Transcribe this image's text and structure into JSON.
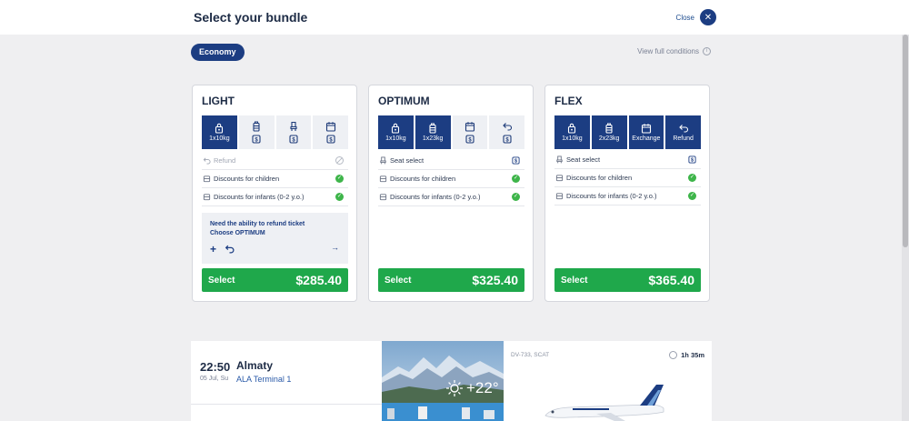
{
  "header": {
    "title": "Select your bundle",
    "close_label": "Close"
  },
  "tab": {
    "label": "Economy"
  },
  "conditions": {
    "label": "View full conditions"
  },
  "colors": {
    "brand": "#1c3d82",
    "select": "#1fa84b",
    "check": "#3eb54a"
  },
  "bundles": [
    {
      "name": "LIGHT",
      "tiles": [
        {
          "icon": "bag-lock-icon",
          "label": "1x10kg",
          "included": true
        },
        {
          "icon": "luggage-icon",
          "label": "",
          "included": false
        },
        {
          "icon": "seat-icon",
          "label": "",
          "included": false
        },
        {
          "icon": "calendar-icon",
          "label": "",
          "included": false
        }
      ],
      "features": [
        {
          "label": "Refund",
          "status": "unavailable"
        },
        {
          "label": "Discounts for children",
          "status": "included"
        },
        {
          "label": "Discounts for infants (0-2 y.o.)",
          "status": "included"
        }
      ],
      "upsell": {
        "line1": "Need the ability to refund ticket",
        "line2": "Choose OPTIMUM"
      },
      "select_label": "Select",
      "price": "$285.40"
    },
    {
      "name": "OPTIMUM",
      "tiles": [
        {
          "icon": "bag-lock-icon",
          "label": "1x10kg",
          "included": true
        },
        {
          "icon": "luggage-icon",
          "label": "1x23kg",
          "included": true
        },
        {
          "icon": "calendar-icon",
          "label": "",
          "included": false
        },
        {
          "icon": "return-icon",
          "label": "",
          "included": false
        }
      ],
      "features": [
        {
          "label": "Seat select",
          "status": "paid"
        },
        {
          "label": "Discounts for children",
          "status": "included"
        },
        {
          "label": "Discounts for infants (0-2 y.o.)",
          "status": "included"
        }
      ],
      "select_label": "Select",
      "price": "$325.40"
    },
    {
      "name": "FLEX",
      "tiles": [
        {
          "icon": "bag-lock-icon",
          "label": "1x10kg",
          "included": true
        },
        {
          "icon": "luggage-icon",
          "label": "2x23kg",
          "included": true
        },
        {
          "icon": "calendar-icon",
          "label": "Exchange",
          "included": true
        },
        {
          "icon": "return-icon",
          "label": "Refund",
          "included": true
        }
      ],
      "features": [
        {
          "label": "Seat select",
          "status": "paid"
        },
        {
          "label": "Discounts for children",
          "status": "included"
        },
        {
          "label": "Discounts for infants (0-2 y.o.)",
          "status": "included"
        }
      ],
      "select_label": "Select",
      "price": "$365.40"
    }
  ],
  "flight": {
    "time": "22:50",
    "date": "05 Jul, Su",
    "city": "Almaty",
    "terminal": "ALA Terminal 1",
    "temperature": "+22°",
    "code": "DV-733, SCAT",
    "duration": "1h 35m"
  }
}
